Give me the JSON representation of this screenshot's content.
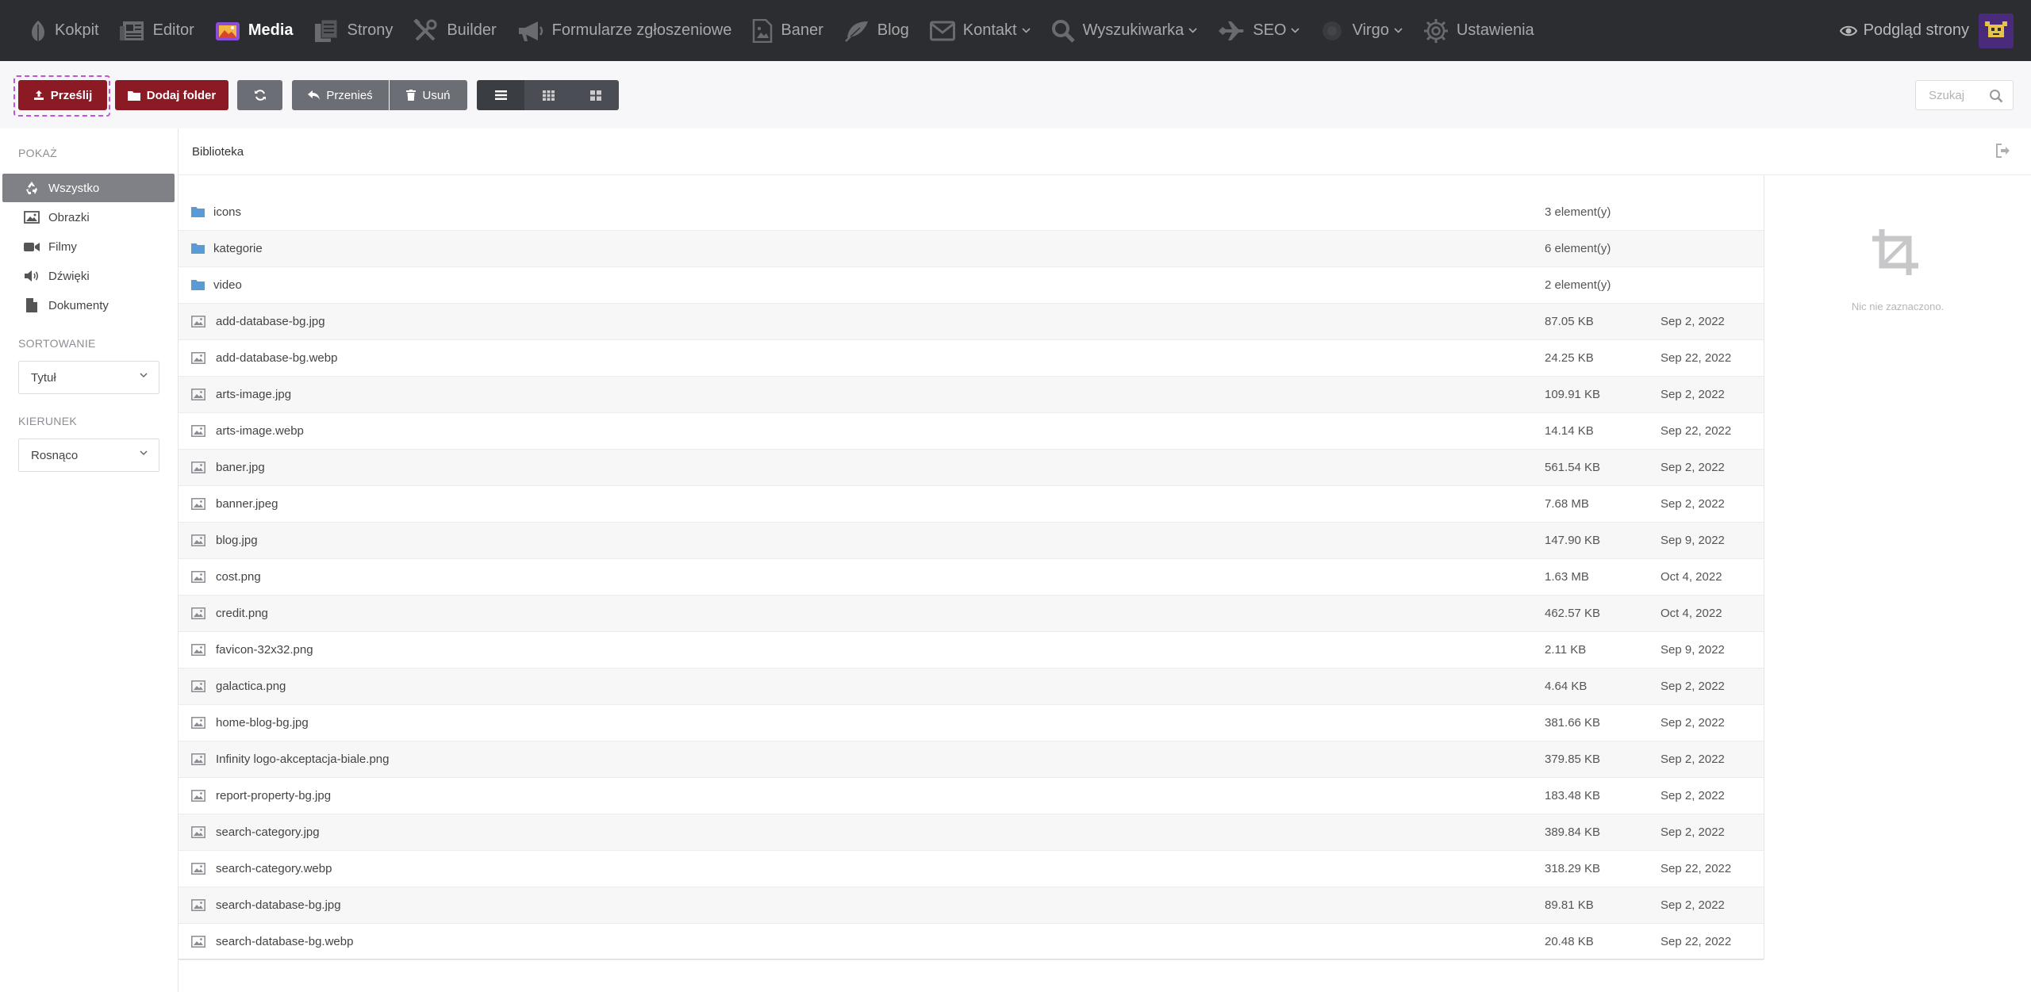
{
  "nav": {
    "items": [
      {
        "label": "Kokpit",
        "icon": "leaf-icon",
        "active": false,
        "dropdown": false
      },
      {
        "label": "Editor",
        "icon": "newspaper-icon",
        "active": false,
        "dropdown": false
      },
      {
        "label": "Media",
        "icon": "photo-icon",
        "active": true,
        "dropdown": false
      },
      {
        "label": "Strony",
        "icon": "pages-icon",
        "active": false,
        "dropdown": false
      },
      {
        "label": "Builder",
        "icon": "tools-icon",
        "active": false,
        "dropdown": false
      },
      {
        "label": "Formularze zgłoszeniowe",
        "icon": "megaphone-icon",
        "active": false,
        "dropdown": false
      },
      {
        "label": "Baner",
        "icon": "image-file-icon",
        "active": false,
        "dropdown": false
      },
      {
        "label": "Blog",
        "icon": "feather-icon",
        "active": false,
        "dropdown": false
      },
      {
        "label": "Kontakt",
        "icon": "envelope-icon",
        "active": false,
        "dropdown": true
      },
      {
        "label": "Wyszukiwarka",
        "icon": "search-icon",
        "active": false,
        "dropdown": true
      },
      {
        "label": "SEO",
        "icon": "plane-icon",
        "active": false,
        "dropdown": true
      },
      {
        "label": "Virgo",
        "icon": "circle-icon",
        "active": false,
        "dropdown": true
      },
      {
        "label": "Ustawienia",
        "icon": "gear-icon",
        "active": false,
        "dropdown": false
      }
    ],
    "preview_label": "Podgląd strony"
  },
  "toolbar": {
    "upload_label": "Prześlij",
    "add_folder_label": "Dodaj folder",
    "move_label": "Przenieś",
    "delete_label": "Usuń",
    "search_placeholder": "Szukaj"
  },
  "sidebar": {
    "show_heading": "POKAŻ",
    "filters": [
      {
        "label": "Wszystko",
        "icon": "recycle-icon",
        "active": true
      },
      {
        "label": "Obrazki",
        "icon": "picture-icon",
        "active": false
      },
      {
        "label": "Filmy",
        "icon": "video-camera-icon",
        "active": false
      },
      {
        "label": "Dźwięki",
        "icon": "speaker-icon",
        "active": false
      },
      {
        "label": "Dokumenty",
        "icon": "document-icon",
        "active": false
      }
    ],
    "sort_heading": "SORTOWANIE",
    "sort_value": "Tytuł",
    "direction_heading": "KIERUNEK",
    "direction_value": "Rosnąco"
  },
  "main": {
    "breadcrumb": "Biblioteka",
    "folders": [
      {
        "name": "icons",
        "count": "3 element(y)"
      },
      {
        "name": "kategorie",
        "count": "6 element(y)"
      },
      {
        "name": "video",
        "count": "2 element(y)"
      }
    ],
    "files": [
      {
        "name": "add-database-bg.jpg",
        "size": "87.05 KB",
        "date": "Sep 2, 2022"
      },
      {
        "name": "add-database-bg.webp",
        "size": "24.25 KB",
        "date": "Sep 22, 2022"
      },
      {
        "name": "arts-image.jpg",
        "size": "109.91 KB",
        "date": "Sep 2, 2022"
      },
      {
        "name": "arts-image.webp",
        "size": "14.14 KB",
        "date": "Sep 22, 2022"
      },
      {
        "name": "baner.jpg",
        "size": "561.54 KB",
        "date": "Sep 2, 2022"
      },
      {
        "name": "banner.jpeg",
        "size": "7.68 MB",
        "date": "Sep 2, 2022"
      },
      {
        "name": "blog.jpg",
        "size": "147.90 KB",
        "date": "Sep 9, 2022"
      },
      {
        "name": "cost.png",
        "size": "1.63 MB",
        "date": "Oct 4, 2022"
      },
      {
        "name": "credit.png",
        "size": "462.57 KB",
        "date": "Oct 4, 2022"
      },
      {
        "name": "favicon-32x32.png",
        "size": "2.11 KB",
        "date": "Sep 9, 2022"
      },
      {
        "name": "galactica.png",
        "size": "4.64 KB",
        "date": "Sep 2, 2022"
      },
      {
        "name": "home-blog-bg.jpg",
        "size": "381.66 KB",
        "date": "Sep 2, 2022"
      },
      {
        "name": "Infinity logo-akceptacja-biale.png",
        "size": "379.85 KB",
        "date": "Sep 2, 2022"
      },
      {
        "name": "report-property-bg.jpg",
        "size": "183.48 KB",
        "date": "Sep 2, 2022"
      },
      {
        "name": "search-category.jpg",
        "size": "389.84 KB",
        "date": "Sep 2, 2022"
      },
      {
        "name": "search-category.webp",
        "size": "318.29 KB",
        "date": "Sep 22, 2022"
      },
      {
        "name": "search-database-bg.jpg",
        "size": "89.81 KB",
        "date": "Sep 2, 2022"
      },
      {
        "name": "search-database-bg.webp",
        "size": "20.48 KB",
        "date": "Sep 22, 2022"
      }
    ]
  },
  "details": {
    "empty_text": "Nic nie zaznaczono."
  },
  "colors": {
    "nav_bg": "#2b2d30",
    "primary_red": "#8b1a25",
    "folder_blue": "#5b9bd5",
    "active_filter": "#7f8187"
  }
}
